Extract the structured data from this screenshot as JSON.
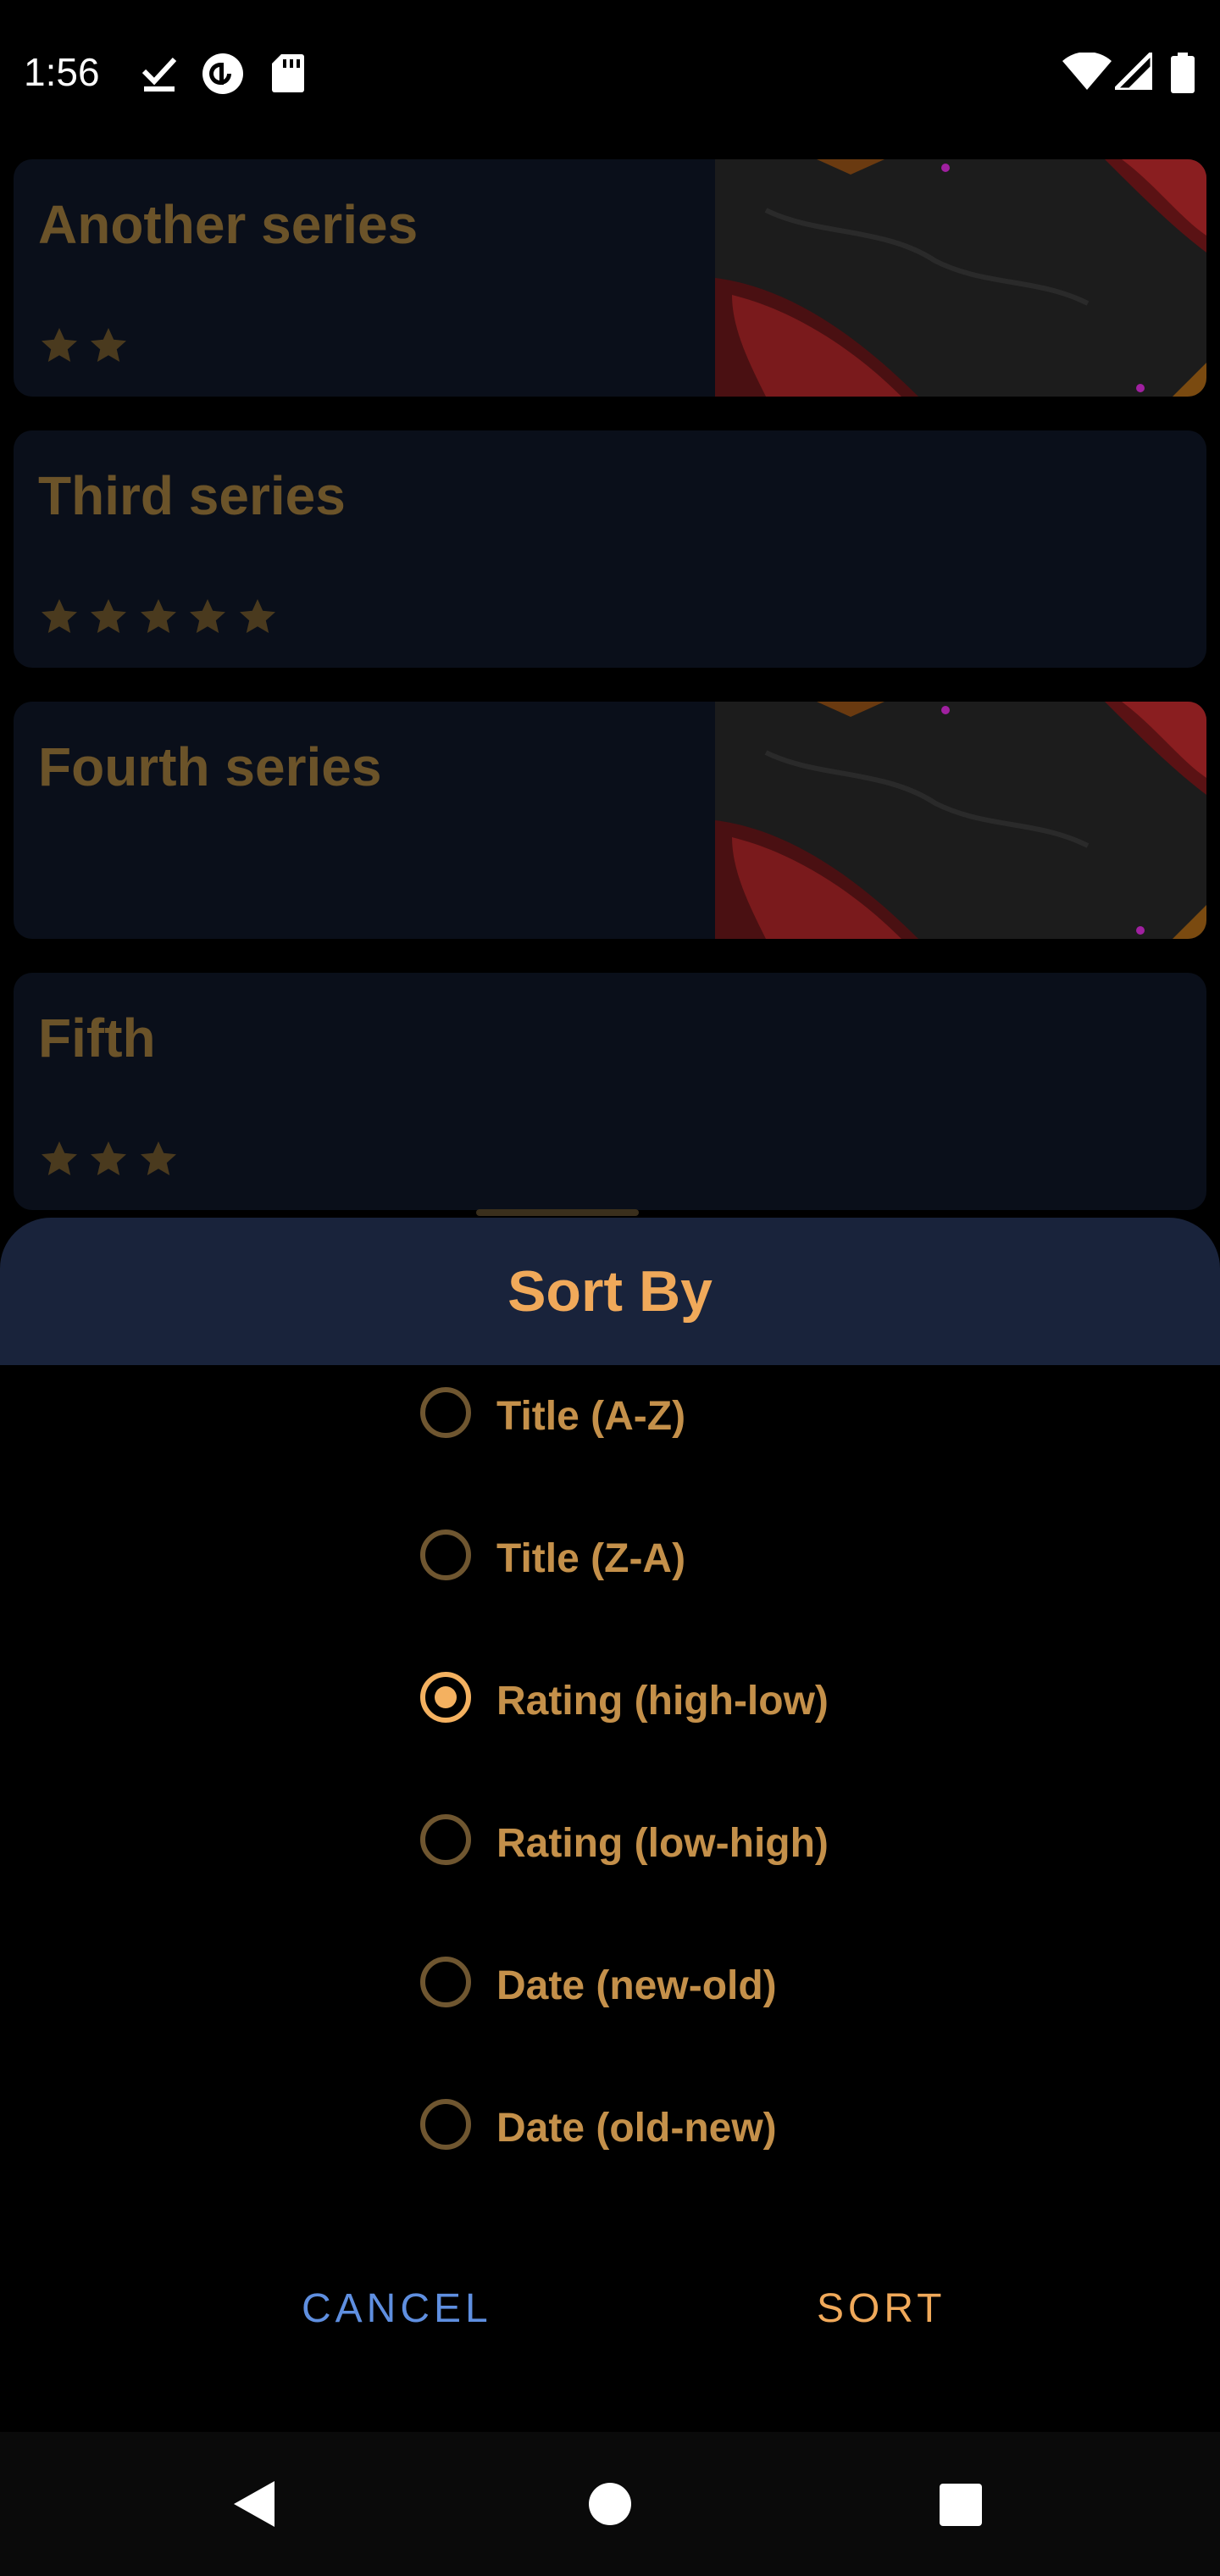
{
  "status_bar": {
    "time": "1:56",
    "left_icons": [
      "download-done-icon",
      "pocket-casts-icon",
      "sd-card-icon"
    ],
    "right_icons": [
      "wifi-icon",
      "cell-signal-icon",
      "battery-icon"
    ]
  },
  "series": [
    {
      "title": "Another series",
      "rating": 2,
      "has_cover": true
    },
    {
      "title": "Third series",
      "rating": 5,
      "has_cover": false
    },
    {
      "title": "Fourth series",
      "rating": 0,
      "has_cover": true
    },
    {
      "title": "Fifth",
      "rating": 3,
      "has_cover": false
    }
  ],
  "sort_sheet": {
    "title": "Sort By",
    "options": [
      {
        "label": "Title (A-Z)",
        "selected": false
      },
      {
        "label": "Title (Z-A)",
        "selected": false
      },
      {
        "label": "Rating (high-low)",
        "selected": true
      },
      {
        "label": "Rating (low-high)",
        "selected": false
      },
      {
        "label": "Date (new-old)",
        "selected": false
      },
      {
        "label": "Date (old-new)",
        "selected": false
      }
    ],
    "cancel_label": "CANCEL",
    "sort_label": "SORT"
  },
  "nav_bar": {
    "icons": [
      "back-icon",
      "home-icon",
      "recents-icon"
    ]
  },
  "colors": {
    "accent": "#f0a95a",
    "card_bg": "#0a0f1a",
    "sheet_header_bg": "#19233b",
    "cancel": "#5f8fe0"
  }
}
